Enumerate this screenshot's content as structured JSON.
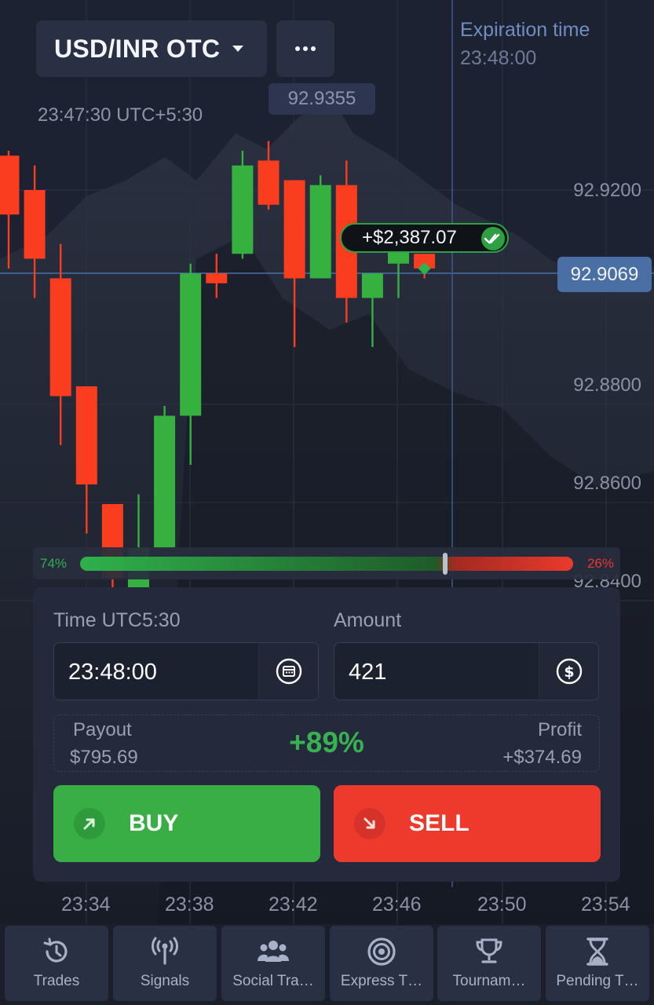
{
  "header": {
    "asset": "USD/INR OTC",
    "chart_time": "23:47:30 UTC+5:30",
    "price_marker": "92.9355",
    "expiration_label": "Expiration time",
    "expiration_value": "23:48:00"
  },
  "chart": {
    "y_axis_labels": [
      "92.9200",
      "92.8800",
      "92.8600",
      "92.8400"
    ],
    "x_axis_labels": [
      "23:34",
      "23:38",
      "23:42",
      "23:46",
      "23:50",
      "23:54"
    ],
    "current_price": "92.9069",
    "trade_result": "+$2,387.07",
    "candles": [
      {
        "o": 92.927,
        "h": 92.928,
        "l": 92.904,
        "c": 92.915
      },
      {
        "o": 92.92,
        "h": 92.925,
        "l": 92.898,
        "c": 92.906
      },
      {
        "o": 92.902,
        "h": 92.909,
        "l": 92.868,
        "c": 92.878
      },
      {
        "o": 92.88,
        "h": 92.88,
        "l": 92.85,
        "c": 92.86
      },
      {
        "o": 92.856,
        "h": 92.856,
        "l": 92.835,
        "c": 92.841
      },
      {
        "o": 92.836,
        "h": 92.858,
        "l": 92.833,
        "c": 92.847
      },
      {
        "o": 92.847,
        "h": 92.876,
        "l": 92.847,
        "c": 92.874
      },
      {
        "o": 92.874,
        "h": 92.905,
        "l": 92.864,
        "c": 92.903
      },
      {
        "o": 92.903,
        "h": 92.907,
        "l": 92.898,
        "c": 92.901
      },
      {
        "o": 92.907,
        "h": 92.928,
        "l": 92.906,
        "c": 92.925
      },
      {
        "o": 92.926,
        "h": 92.93,
        "l": 92.916,
        "c": 92.917
      },
      {
        "o": 92.922,
        "h": 92.922,
        "l": 92.888,
        "c": 92.902
      },
      {
        "o": 92.902,
        "h": 92.923,
        "l": 92.902,
        "c": 92.921
      },
      {
        "o": 92.921,
        "h": 92.926,
        "l": 92.893,
        "c": 92.898
      },
      {
        "o": 92.898,
        "h": 92.903,
        "l": 92.888,
        "c": 92.903
      },
      {
        "o": 92.905,
        "h": 92.908,
        "l": 92.898,
        "c": 92.908
      },
      {
        "o": 92.907,
        "h": 92.907,
        "l": 92.902,
        "c": 92.904
      }
    ],
    "up_color": "#36b140",
    "down_color": "#fa3d1f"
  },
  "sentiment": {
    "buy_pct_label": "74%",
    "sell_pct_label": "26%",
    "buy_fraction": 0.74
  },
  "trade_panel": {
    "time_label": "Time UTC5:30",
    "time_value": "23:48:00",
    "amount_label": "Amount",
    "amount_value": "421",
    "payout_label": "Payout",
    "payout_value": "$795.69",
    "payout_percent": "+89%",
    "profit_label": "Profit",
    "profit_value": "+$374.69",
    "buy_label": "BUY",
    "sell_label": "SELL",
    "buy_color": "#38ae44",
    "sell_color": "#ee3a2c"
  },
  "bottom_nav": [
    {
      "label": "Trades",
      "icon": "history-icon"
    },
    {
      "label": "Signals",
      "icon": "signal-antenna-icon"
    },
    {
      "label": "Social Tra…",
      "icon": "users-icon"
    },
    {
      "label": "Express T…",
      "icon": "target-icon"
    },
    {
      "label": "Tournam…",
      "icon": "trophy-icon"
    },
    {
      "label": "Pending T…",
      "icon": "hourglass-icon"
    }
  ]
}
